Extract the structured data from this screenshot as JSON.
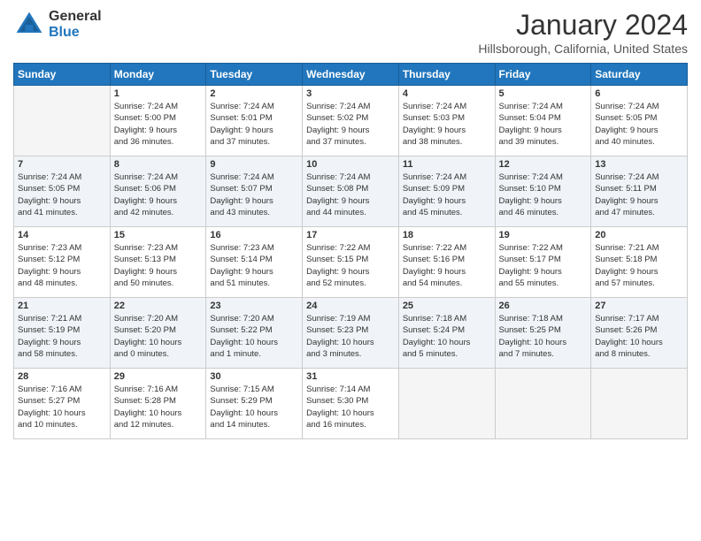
{
  "header": {
    "logo_general": "General",
    "logo_blue": "Blue",
    "title": "January 2024",
    "location": "Hillsborough, California, United States"
  },
  "days_of_week": [
    "Sunday",
    "Monday",
    "Tuesday",
    "Wednesday",
    "Thursday",
    "Friday",
    "Saturday"
  ],
  "weeks": [
    {
      "days": [
        {
          "number": "",
          "info": ""
        },
        {
          "number": "1",
          "info": "Sunrise: 7:24 AM\nSunset: 5:00 PM\nDaylight: 9 hours\nand 36 minutes."
        },
        {
          "number": "2",
          "info": "Sunrise: 7:24 AM\nSunset: 5:01 PM\nDaylight: 9 hours\nand 37 minutes."
        },
        {
          "number": "3",
          "info": "Sunrise: 7:24 AM\nSunset: 5:02 PM\nDaylight: 9 hours\nand 37 minutes."
        },
        {
          "number": "4",
          "info": "Sunrise: 7:24 AM\nSunset: 5:03 PM\nDaylight: 9 hours\nand 38 minutes."
        },
        {
          "number": "5",
          "info": "Sunrise: 7:24 AM\nSunset: 5:04 PM\nDaylight: 9 hours\nand 39 minutes."
        },
        {
          "number": "6",
          "info": "Sunrise: 7:24 AM\nSunset: 5:05 PM\nDaylight: 9 hours\nand 40 minutes."
        }
      ]
    },
    {
      "days": [
        {
          "number": "7",
          "info": "Sunrise: 7:24 AM\nSunset: 5:05 PM\nDaylight: 9 hours\nand 41 minutes."
        },
        {
          "number": "8",
          "info": "Sunrise: 7:24 AM\nSunset: 5:06 PM\nDaylight: 9 hours\nand 42 minutes."
        },
        {
          "number": "9",
          "info": "Sunrise: 7:24 AM\nSunset: 5:07 PM\nDaylight: 9 hours\nand 43 minutes."
        },
        {
          "number": "10",
          "info": "Sunrise: 7:24 AM\nSunset: 5:08 PM\nDaylight: 9 hours\nand 44 minutes."
        },
        {
          "number": "11",
          "info": "Sunrise: 7:24 AM\nSunset: 5:09 PM\nDaylight: 9 hours\nand 45 minutes."
        },
        {
          "number": "12",
          "info": "Sunrise: 7:24 AM\nSunset: 5:10 PM\nDaylight: 9 hours\nand 46 minutes."
        },
        {
          "number": "13",
          "info": "Sunrise: 7:24 AM\nSunset: 5:11 PM\nDaylight: 9 hours\nand 47 minutes."
        }
      ]
    },
    {
      "days": [
        {
          "number": "14",
          "info": "Sunrise: 7:23 AM\nSunset: 5:12 PM\nDaylight: 9 hours\nand 48 minutes."
        },
        {
          "number": "15",
          "info": "Sunrise: 7:23 AM\nSunset: 5:13 PM\nDaylight: 9 hours\nand 50 minutes."
        },
        {
          "number": "16",
          "info": "Sunrise: 7:23 AM\nSunset: 5:14 PM\nDaylight: 9 hours\nand 51 minutes."
        },
        {
          "number": "17",
          "info": "Sunrise: 7:22 AM\nSunset: 5:15 PM\nDaylight: 9 hours\nand 52 minutes."
        },
        {
          "number": "18",
          "info": "Sunrise: 7:22 AM\nSunset: 5:16 PM\nDaylight: 9 hours\nand 54 minutes."
        },
        {
          "number": "19",
          "info": "Sunrise: 7:22 AM\nSunset: 5:17 PM\nDaylight: 9 hours\nand 55 minutes."
        },
        {
          "number": "20",
          "info": "Sunrise: 7:21 AM\nSunset: 5:18 PM\nDaylight: 9 hours\nand 57 minutes."
        }
      ]
    },
    {
      "days": [
        {
          "number": "21",
          "info": "Sunrise: 7:21 AM\nSunset: 5:19 PM\nDaylight: 9 hours\nand 58 minutes."
        },
        {
          "number": "22",
          "info": "Sunrise: 7:20 AM\nSunset: 5:20 PM\nDaylight: 10 hours\nand 0 minutes."
        },
        {
          "number": "23",
          "info": "Sunrise: 7:20 AM\nSunset: 5:22 PM\nDaylight: 10 hours\nand 1 minute."
        },
        {
          "number": "24",
          "info": "Sunrise: 7:19 AM\nSunset: 5:23 PM\nDaylight: 10 hours\nand 3 minutes."
        },
        {
          "number": "25",
          "info": "Sunrise: 7:18 AM\nSunset: 5:24 PM\nDaylight: 10 hours\nand 5 minutes."
        },
        {
          "number": "26",
          "info": "Sunrise: 7:18 AM\nSunset: 5:25 PM\nDaylight: 10 hours\nand 7 minutes."
        },
        {
          "number": "27",
          "info": "Sunrise: 7:17 AM\nSunset: 5:26 PM\nDaylight: 10 hours\nand 8 minutes."
        }
      ]
    },
    {
      "days": [
        {
          "number": "28",
          "info": "Sunrise: 7:16 AM\nSunset: 5:27 PM\nDaylight: 10 hours\nand 10 minutes."
        },
        {
          "number": "29",
          "info": "Sunrise: 7:16 AM\nSunset: 5:28 PM\nDaylight: 10 hours\nand 12 minutes."
        },
        {
          "number": "30",
          "info": "Sunrise: 7:15 AM\nSunset: 5:29 PM\nDaylight: 10 hours\nand 14 minutes."
        },
        {
          "number": "31",
          "info": "Sunrise: 7:14 AM\nSunset: 5:30 PM\nDaylight: 10 hours\nand 16 minutes."
        },
        {
          "number": "",
          "info": ""
        },
        {
          "number": "",
          "info": ""
        },
        {
          "number": "",
          "info": ""
        }
      ]
    }
  ]
}
